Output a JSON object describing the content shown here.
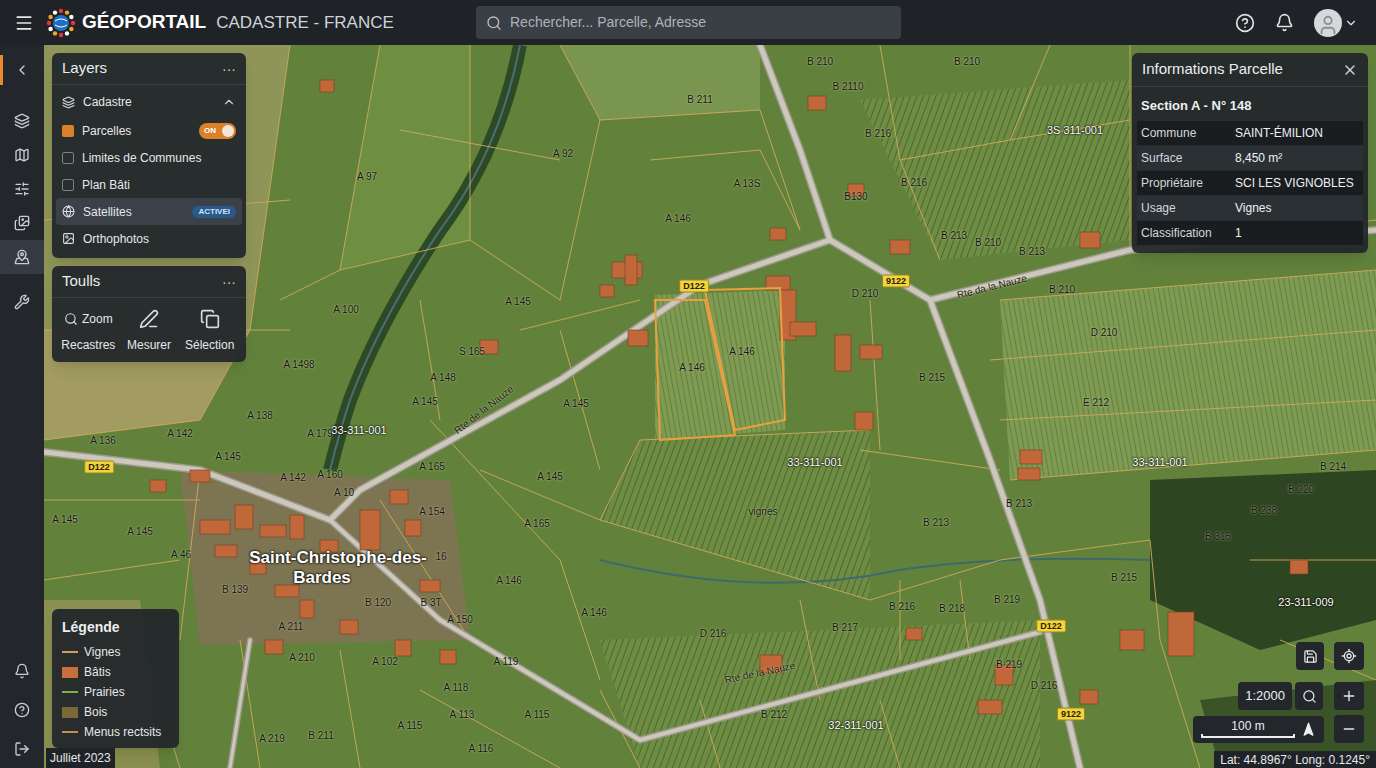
{
  "header": {
    "logo_text": "GÉOPORTAIL",
    "subtitle": "CADASTRE - FRANCE",
    "search_placeholder": "Rechercher... Parcelle, Adresse"
  },
  "sidebar": {
    "items": [
      {
        "selected": true
      },
      {
        "selected": false
      },
      {
        "selected": false
      },
      {
        "selected": false
      },
      {
        "selected": false
      },
      {
        "selected": true
      },
      {
        "selected": false
      }
    ],
    "bottom_items": [
      {
        "selected": false
      },
      {
        "selected": false
      },
      {
        "selected": false
      }
    ]
  },
  "layers_panel": {
    "title": "Layers",
    "menu": "···",
    "group": {
      "label": "Cadastre",
      "expanded": true
    },
    "items": [
      {
        "label": "Parcelles",
        "kind": "checkbox",
        "checked": true,
        "toggle": {
          "on": true,
          "label": "ON"
        }
      },
      {
        "label": "Limites de Communes",
        "kind": "checkbox",
        "checked": false
      },
      {
        "label": "Plan Bâti",
        "kind": "checkbox",
        "checked": false
      },
      {
        "label": "Satellites",
        "kind": "imagery",
        "selected": true,
        "badge": "ACTIVEI"
      },
      {
        "label": "Orthophotos",
        "kind": "imagery",
        "selected": false
      }
    ]
  },
  "tools_panel": {
    "title": "Toulls",
    "menu": "···",
    "items": [
      {
        "label": "Recastres",
        "caption": "Zoom"
      },
      {
        "label": "Mesurer"
      },
      {
        "label": "Sélection"
      }
    ]
  },
  "info_panel": {
    "title": "Informations Parcelle",
    "heading": "Section A - N° 148",
    "rows": [
      {
        "label": "Commune",
        "value": "SAINT-ÉMILION"
      },
      {
        "label": "Surface",
        "value": "8,450 m²"
      },
      {
        "label": "Propriétaire",
        "value": "SCI LES VIGNOBLES"
      },
      {
        "label": "Usage",
        "value": "Vignes"
      },
      {
        "label": "Classification",
        "value": "1"
      }
    ]
  },
  "legend": {
    "title": "Légende",
    "items": [
      {
        "label": "Vignes",
        "kind": "line",
        "color": "#c9a35a"
      },
      {
        "label": "Bâtis",
        "kind": "swatch",
        "color": "#c8703a"
      },
      {
        "label": "Prairies",
        "kind": "line",
        "color": "#7cb342"
      },
      {
        "label": "Bois",
        "kind": "swatch",
        "color": "#7a6838"
      },
      {
        "label": "Menus rectsits",
        "kind": "line",
        "color": "#d08a4a"
      }
    ]
  },
  "footer": {
    "date": "Julliet 2023",
    "scale": "1:2000",
    "scale_bar": "100 m",
    "coords": "Lat: 44.8967° Long: 0.1245°"
  },
  "map": {
    "labels": [
      {
        "text": "B 210",
        "kind": "parcel"
      },
      {
        "text": "B 211",
        "kind": "parcel"
      },
      {
        "text": "B 210",
        "kind": "parcel"
      },
      {
        "text": "B 2110",
        "kind": "parcel"
      },
      {
        "text": "B 216",
        "kind": "parcel"
      },
      {
        "text": "3S 311-001",
        "kind": "commune"
      },
      {
        "text": "A 92",
        "kind": "parcel"
      },
      {
        "text": "A 97",
        "kind": "parcel"
      },
      {
        "text": "A 13S",
        "kind": "parcel"
      },
      {
        "text": "B 216",
        "kind": "parcel"
      },
      {
        "text": "B130",
        "kind": "parcel"
      },
      {
        "text": "A 146",
        "kind": "parcel"
      },
      {
        "text": "B 213",
        "kind": "parcel"
      },
      {
        "text": "B 210",
        "kind": "parcel"
      },
      {
        "text": "B 213",
        "kind": "parcel"
      },
      {
        "text": "D122",
        "kind": "road"
      },
      {
        "text": "9122",
        "kind": "road"
      },
      {
        "text": "Rte da la Nauze",
        "kind": "street"
      },
      {
        "text": "A 145",
        "kind": "parcel"
      },
      {
        "text": "D 210",
        "kind": "parcel"
      },
      {
        "text": "B 210",
        "kind": "parcel"
      },
      {
        "text": "A 100",
        "kind": "parcel"
      },
      {
        "text": "D 210",
        "kind": "parcel"
      },
      {
        "text": "S 165",
        "kind": "parcel"
      },
      {
        "text": "A 146",
        "kind": "parcel"
      },
      {
        "text": "A 146",
        "kind": "parcel"
      },
      {
        "text": "B 215",
        "kind": "parcel"
      },
      {
        "text": "A 1498",
        "kind": "parcel"
      },
      {
        "text": "A 148",
        "kind": "parcel"
      },
      {
        "text": "Rte de la Nauze",
        "kind": "street"
      },
      {
        "text": "A 145",
        "kind": "parcel"
      },
      {
        "text": "A 145",
        "kind": "parcel"
      },
      {
        "text": "E 212",
        "kind": "parcel"
      },
      {
        "text": "A 138",
        "kind": "parcel"
      },
      {
        "text": "A 142",
        "kind": "parcel"
      },
      {
        "text": "A 136",
        "kind": "parcel"
      },
      {
        "text": "A 179",
        "kind": "parcel"
      },
      {
        "text": "33-311-001",
        "kind": "commune"
      },
      {
        "text": "A 145",
        "kind": "parcel"
      },
      {
        "text": "D122",
        "kind": "road"
      },
      {
        "text": "33-311-001",
        "kind": "commune"
      },
      {
        "text": "33-311-001",
        "kind": "commune"
      },
      {
        "text": "B 214",
        "kind": "parcel"
      },
      {
        "text": "A 142",
        "kind": "parcel"
      },
      {
        "text": "A 160",
        "kind": "parcel"
      },
      {
        "text": "A 165",
        "kind": "parcel"
      },
      {
        "text": "A 145",
        "kind": "parcel"
      },
      {
        "text": "B 220",
        "kind": "parcel"
      },
      {
        "text": "A 10",
        "kind": "parcel"
      },
      {
        "text": "B 213",
        "kind": "parcel"
      },
      {
        "text": "vignes",
        "kind": "parcel"
      },
      {
        "text": "A 154",
        "kind": "parcel"
      },
      {
        "text": "B 238",
        "kind": "parcel"
      },
      {
        "text": "A 145",
        "kind": "parcel"
      },
      {
        "text": "B 213",
        "kind": "parcel"
      },
      {
        "text": "A 165",
        "kind": "parcel"
      },
      {
        "text": "A 145",
        "kind": "parcel"
      },
      {
        "text": "B 315",
        "kind": "parcel"
      },
      {
        "text": "A 46",
        "kind": "parcel"
      },
      {
        "text": "Saint-Christophe-des-",
        "kind": "town"
      },
      {
        "text": "Bardes",
        "kind": "town"
      },
      {
        "text": "16",
        "kind": "parcel"
      },
      {
        "text": "B 215",
        "kind": "parcel"
      },
      {
        "text": "A 146",
        "kind": "parcel"
      },
      {
        "text": "B 139",
        "kind": "parcel"
      },
      {
        "text": "23-311-009",
        "kind": "commune"
      },
      {
        "text": "B 120",
        "kind": "parcel"
      },
      {
        "text": "B 3T",
        "kind": "parcel"
      },
      {
        "text": "B 219",
        "kind": "parcel"
      },
      {
        "text": "B 216",
        "kind": "parcel"
      },
      {
        "text": "B 218",
        "kind": "parcel"
      },
      {
        "text": "A 146",
        "kind": "parcel"
      },
      {
        "text": "A 150",
        "kind": "parcel"
      },
      {
        "text": "D122",
        "kind": "road"
      },
      {
        "text": "A 211",
        "kind": "parcel"
      },
      {
        "text": "B 217",
        "kind": "parcel"
      },
      {
        "text": "D 216",
        "kind": "parcel"
      },
      {
        "text": "A 210",
        "kind": "parcel"
      },
      {
        "text": "A 102",
        "kind": "parcel"
      },
      {
        "text": "A 119",
        "kind": "parcel"
      },
      {
        "text": "B 219",
        "kind": "parcel"
      },
      {
        "text": "Rte de la Nauze",
        "kind": "street"
      },
      {
        "text": "D 216",
        "kind": "parcel"
      },
      {
        "text": "A 118",
        "kind": "parcel"
      },
      {
        "text": "9122",
        "kind": "road"
      },
      {
        "text": "A 113",
        "kind": "parcel"
      },
      {
        "text": "A 115",
        "kind": "parcel"
      },
      {
        "text": "B 212",
        "kind": "parcel"
      },
      {
        "text": "32-311-001",
        "kind": "commune"
      },
      {
        "text": "A 115",
        "kind": "parcel"
      },
      {
        "text": "B 211",
        "kind": "parcel"
      },
      {
        "text": "A 219",
        "kind": "parcel"
      },
      {
        "text": "A 116",
        "kind": "parcel"
      }
    ]
  }
}
